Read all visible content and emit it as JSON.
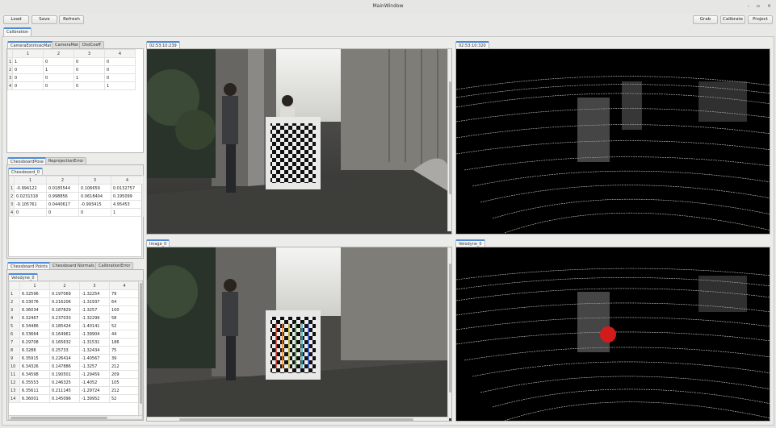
{
  "window": {
    "title": "MainWindow",
    "controls": [
      "-",
      "▫",
      "×"
    ]
  },
  "toolbar": {
    "load": "Load",
    "save": "Save",
    "refresh": "Refresh",
    "grab": "Grab",
    "calibrate": "Calibrate",
    "project": "Project"
  },
  "main_tab": "Calibration",
  "extrinsic": {
    "tabs": [
      "CameraExtrinsicMat",
      "CameraMat",
      "DistCoeff"
    ],
    "cols": [
      "1",
      "2",
      "3",
      "4"
    ],
    "rows": [
      {
        "h": "1",
        "c": [
          "1",
          "0",
          "0",
          "0"
        ]
      },
      {
        "h": "2",
        "c": [
          "0",
          "1",
          "0",
          "0"
        ]
      },
      {
        "h": "3",
        "c": [
          "0",
          "0",
          "1",
          "0"
        ]
      },
      {
        "h": "4",
        "c": [
          "0",
          "0",
          "0",
          "1"
        ]
      }
    ]
  },
  "pose": {
    "tabs": [
      "ChessboardPose",
      "ReprojectionError"
    ],
    "subtab": "Chessboard_0",
    "cols": [
      "1",
      "2",
      "3",
      "4"
    ],
    "rows": [
      {
        "h": "1",
        "c": [
          "-0.994122",
          "0.0185544",
          "0.106659",
          "0.0132757"
        ]
      },
      {
        "h": "2",
        "c": [
          "0.0231318",
          "0.998856",
          "0.0618404",
          "0.195099"
        ]
      },
      {
        "h": "3",
        "c": [
          "-0.105761",
          "0.0440617",
          "-0.993415",
          "4.95453"
        ]
      },
      {
        "h": "4",
        "c": [
          "0",
          "0",
          "0",
          "1"
        ]
      }
    ]
  },
  "points": {
    "tabs": [
      "Chessboard Points",
      "Chessboard Normals",
      "CalibrationError"
    ],
    "subtab": "Velodyne_0",
    "cols": [
      "1",
      "2",
      "3",
      "4"
    ],
    "rows": [
      {
        "h": "1",
        "c": [
          "6.32596",
          "0.197069",
          "-1.32254",
          "79"
        ]
      },
      {
        "h": "2",
        "c": [
          "6.33076",
          "0.216206",
          "-1.31937",
          "64"
        ]
      },
      {
        "h": "3",
        "c": [
          "6.36034",
          "0.187829",
          "-1.3257",
          "100"
        ]
      },
      {
        "h": "4",
        "c": [
          "6.32467",
          "0.237033",
          "-1.32299",
          "58"
        ]
      },
      {
        "h": "5",
        "c": [
          "6.34486",
          "0.185424",
          "-1.40141",
          "52"
        ]
      },
      {
        "h": "6",
        "c": [
          "6.33664",
          "0.164961",
          "-1.39904",
          "44"
        ]
      },
      {
        "h": "7",
        "c": [
          "6.29708",
          "0.165632",
          "-1.31531",
          "186"
        ]
      },
      {
        "h": "8",
        "c": [
          "6.3288",
          "0.25733",
          "-1.32434",
          "75"
        ]
      },
      {
        "h": "9",
        "c": [
          "6.35915",
          "0.226414",
          "-1.40567",
          "39"
        ]
      },
      {
        "h": "10",
        "c": [
          "6.34326",
          "0.147886",
          "-1.3257",
          "212"
        ]
      },
      {
        "h": "11",
        "c": [
          "6.34598",
          "0.190501",
          "-1.29459",
          "209"
        ]
      },
      {
        "h": "12",
        "c": [
          "6.35553",
          "0.246325",
          "-1.4052",
          "105"
        ]
      },
      {
        "h": "13",
        "c": [
          "6.35611",
          "0.211145",
          "-1.29724",
          "212"
        ]
      },
      {
        "h": "14",
        "c": [
          "6.36001",
          "0.145096",
          "-1.39952",
          "52"
        ]
      }
    ]
  },
  "views": {
    "camera_tab": "02:53:10:239",
    "lidar_tab": "02:53:10:320",
    "image_tab": "Image_0",
    "velodyne_tab": "Velodyne_0"
  }
}
